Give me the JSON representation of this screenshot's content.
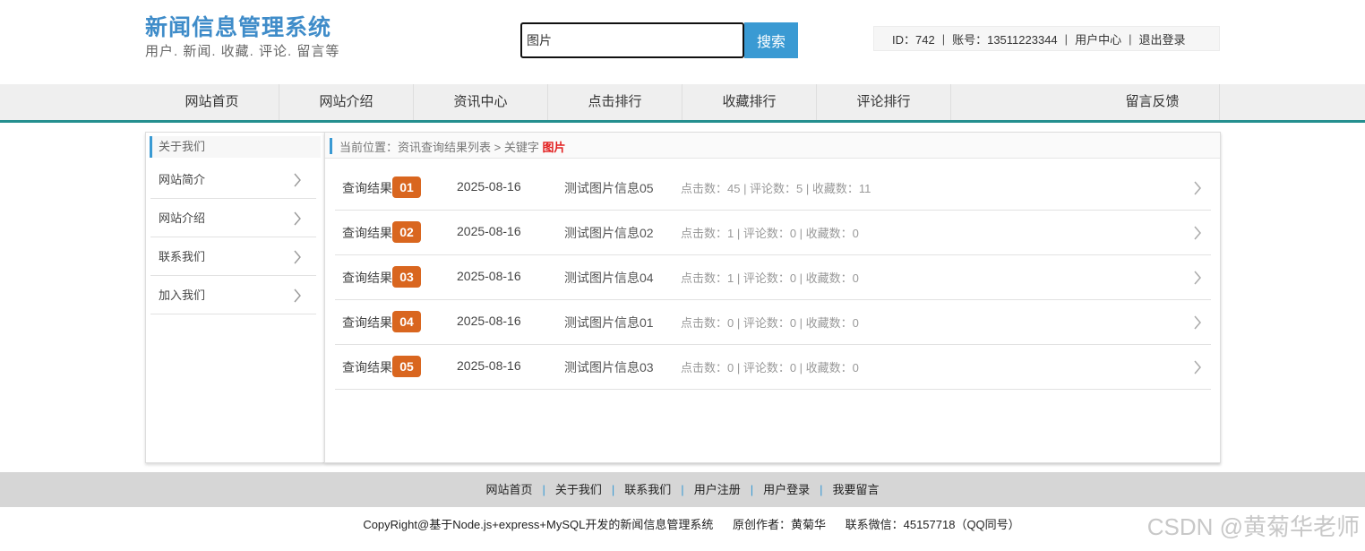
{
  "header": {
    "title": "新闻信息管理系统",
    "subtitle": "用户. 新闻. 收藏. 评论. 留言等"
  },
  "search": {
    "value": "图片",
    "button_label": "搜索"
  },
  "userbar": {
    "id_text": "ID：742",
    "account_text": "账号：13511223344",
    "user_center": "用户中心",
    "logout": "退出登录",
    "separator": "|"
  },
  "nav": {
    "items": [
      {
        "label": "网站首页"
      },
      {
        "label": "网站介绍"
      },
      {
        "label": "资讯中心"
      },
      {
        "label": "点击排行"
      },
      {
        "label": "收藏排行"
      },
      {
        "label": "评论排行"
      },
      {
        "label": "留言反馈"
      }
    ]
  },
  "sidebar": {
    "title": "关于我们",
    "items": [
      {
        "label": "网站简介"
      },
      {
        "label": "网站介绍"
      },
      {
        "label": "联系我们"
      },
      {
        "label": "加入我们"
      }
    ]
  },
  "breadcrumb": {
    "text": "当前位置：资讯查询结果列表 > 关键字",
    "keyword": "图片"
  },
  "results": [
    {
      "label": "查询结果",
      "badge": "01",
      "date": "2025-08-16",
      "title": "测试图片信息05",
      "stats": "点击数：45 | 评论数：5 | 收藏数：11"
    },
    {
      "label": "查询结果",
      "badge": "02",
      "date": "2025-08-16",
      "title": "测试图片信息02",
      "stats": "点击数：1 | 评论数：0 | 收藏数：0"
    },
    {
      "label": "查询结果",
      "badge": "03",
      "date": "2025-08-16",
      "title": "测试图片信息04",
      "stats": "点击数：1 | 评论数：0 | 收藏数：0"
    },
    {
      "label": "查询结果",
      "badge": "04",
      "date": "2025-08-16",
      "title": "测试图片信息01",
      "stats": "点击数：0 | 评论数：0 | 收藏数：0"
    },
    {
      "label": "查询结果",
      "badge": "05",
      "date": "2025-08-16",
      "title": "测试图片信息03",
      "stats": "点击数：0 | 评论数：0 | 收藏数：0"
    }
  ],
  "footer": {
    "links": [
      {
        "label": "网站首页"
      },
      {
        "label": "关于我们"
      },
      {
        "label": "联系我们"
      },
      {
        "label": "用户注册"
      },
      {
        "label": "用户登录"
      },
      {
        "label": "我要留言"
      }
    ],
    "separator": "|",
    "copyright": "CopyRight@基于Node.js+express+MySQL开发的新闻信息管理系统",
    "author": "原创作者：黄菊华",
    "contact": "联系微信：45157718（QQ同号）"
  },
  "watermark": "CSDN @黄菊华老师",
  "colors": {
    "brand": "#3f8cc9",
    "accent": "#3a9ad3",
    "nav_line": "#248f8f",
    "badge": "#d9661f",
    "keyword": "#e21d1d"
  },
  "icons": {
    "row_arrow": "chevron-right-icon",
    "side_arrow": "chevron-right-icon"
  }
}
